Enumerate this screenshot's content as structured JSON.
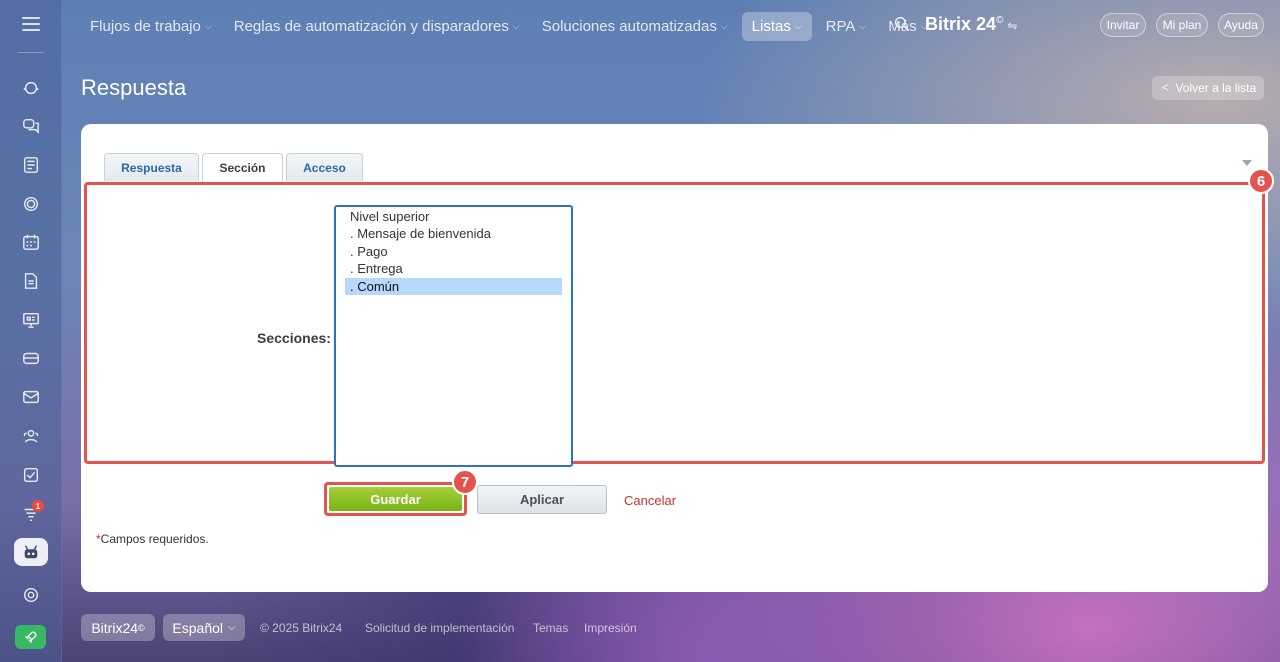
{
  "sidebar": {
    "icons": [
      "bot-icon",
      "chat-icon",
      "feed-icon",
      "crm-icon",
      "calendar-icon",
      "documents-icon",
      "presentation-icon",
      "card-icon",
      "mail-icon",
      "people-icon",
      "tasks-icon",
      "filter-icon",
      "robot-icon",
      "settings-icon",
      "rocket-icon"
    ],
    "badge_count": "1"
  },
  "topnav": {
    "items": [
      {
        "label": "Flujos de trabajo",
        "chevron": "⌵"
      },
      {
        "label": "Reglas de automatización y disparadores",
        "chevron": "⌵"
      },
      {
        "label": "Soluciones automatizadas",
        "chevron": "⌵"
      },
      {
        "label": "Listas",
        "chevron": "⌵"
      },
      {
        "label": "RPA",
        "chevron": "⌵"
      },
      {
        "label": "Más",
        "chevron": "⌵"
      }
    ],
    "brand": "Bitrix 24",
    "brand_sup": "©",
    "brand_settings": "⇋",
    "invite_label": "Invitar",
    "plan_label": "Mi plan",
    "help_label": "Ayuda"
  },
  "page": {
    "title": "Respuesta",
    "back_chevron": "<",
    "back_label": "Volver a la lista"
  },
  "tabs": [
    {
      "label": "Respuesta"
    },
    {
      "label": "Sección"
    },
    {
      "label": "Acceso"
    }
  ],
  "form": {
    "sections_label": "Secciones:",
    "options": [
      "Nivel superior",
      ". Mensaje de bienvenida",
      ". Pago",
      ". Entrega",
      ". Común"
    ],
    "selected": ". Común",
    "save_label": "Guardar",
    "apply_label": "Aplicar",
    "cancel_label": "Cancelar",
    "required_star": "*",
    "required_note": "Campos requeridos."
  },
  "markers": {
    "form_marker": "6",
    "save_marker": "7"
  },
  "footer": {
    "brand": "Bitrix24",
    "brand_sup": "©",
    "language": "Español",
    "language_chevron": "⌵",
    "copyright": "© 2025 Bitrix24",
    "implementation": "Solicitud de implementación",
    "themes": "Temas",
    "print": "Impresión"
  },
  "colors": {
    "accent_red": "#e4534d",
    "save_green": "#8bc226",
    "link_blue": "#2a6aa6",
    "selection": "#b7d8fb",
    "rocket_green": "#38b865"
  }
}
